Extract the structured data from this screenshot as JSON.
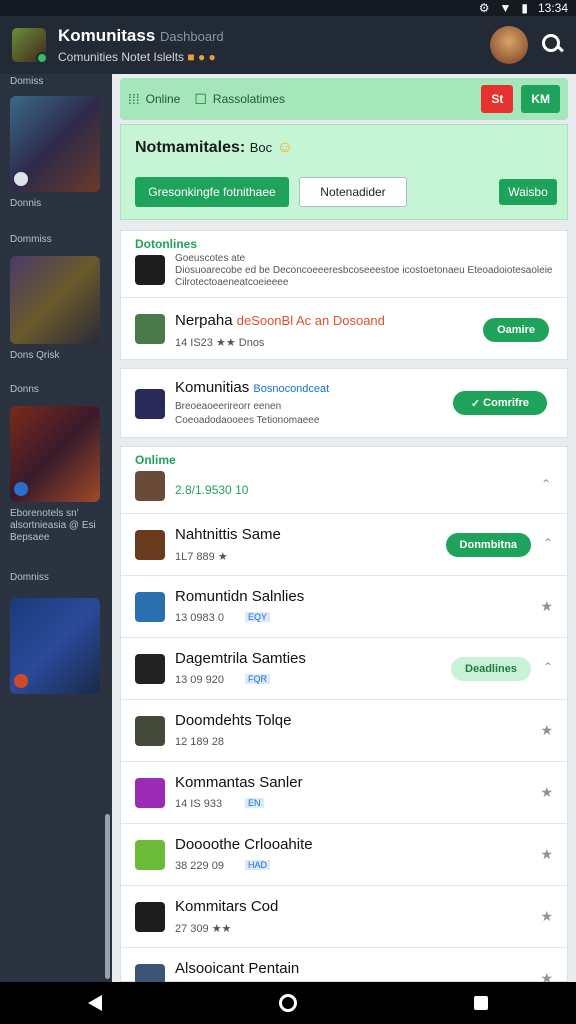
{
  "status": {
    "time": "13:34"
  },
  "header": {
    "title": "Komunitass",
    "title_suffix": "Dashboard",
    "subtitle": "Comunities Notet Islelts"
  },
  "sidebar": {
    "items": [
      {
        "label": "Donnis"
      },
      {
        "label": "Dons Qrisk"
      },
      {
        "label": "Eborenotels sn' alsortnieasia @ Esi Bepsaee"
      },
      {
        "label": ""
      }
    ],
    "headers": [
      "Domiss",
      "Dommiss",
      "Donns",
      "Domniss"
    ]
  },
  "topbar": {
    "label": "Online",
    "text": "Rassolatimes",
    "red_btn": "St",
    "green_btn": "KM"
  },
  "banner": {
    "title": "Notmamitales:",
    "tag": "Boc",
    "primary": "Gresonkingfe fotnithaee",
    "secondary": "Notenadider",
    "small_btn": "Waisbo"
  },
  "section1": {
    "label": "Dotonlines",
    "intro_line1": "Goeuscotes ate",
    "intro_line2": "Diosuoarecobe ed be Deconcoeeeresbcoseeestoe icostoetonaeu Eteoadoiotesaoleie",
    "intro_line3": "Cilrotectoaeneatcoeieeee"
  },
  "featured1": {
    "title": "Nerpaha",
    "accent": "deSoonBl Ac an Dosoand",
    "meta": "14 IS23 ★★ Dnos",
    "button": "Oamire"
  },
  "featured2": {
    "title": "Komunitias",
    "accent": "Bosnocondceat",
    "meta1": "Breoeaoeerireorr eenen",
    "meta2": "Coeoadodaooees Tetionomaeee",
    "button": "Comrifre"
  },
  "section2": {
    "label": "Onlime",
    "first": {
      "value": "2.8/1.9530",
      "badge": "10"
    },
    "rows": [
      {
        "title": "Nahtnittis Same",
        "meta": "1L7 889 ★",
        "button": "Donmbitna",
        "color": "#6a3a1f"
      },
      {
        "title": "Romuntidn Salnlies",
        "meta": "13 0983 0",
        "tag": "EQY",
        "color": "#2a6fb0"
      },
      {
        "title": "Dagemtrila Samties",
        "meta": "13 09 920",
        "tag": "FQR",
        "button": "Deadlines",
        "color": "#222222"
      },
      {
        "title": "Doomdehts Tolqe",
        "meta": "12 189 28",
        "color": "#444a3a"
      },
      {
        "title": "Kommantas Sanler",
        "meta": "14 IS 933",
        "tag": "EN",
        "color": "#9b2bb5"
      },
      {
        "title": "Doooothe Crlooahite",
        "meta": "38 229 09",
        "tag": "HAD",
        "color": "#6cbc3a"
      },
      {
        "title": "Kommitars Cod",
        "meta": "27 309 ★★",
        "color": "#1d1d1d"
      },
      {
        "title": "Alsooicant Pentain",
        "meta": "",
        "color": "#3a5575"
      }
    ]
  },
  "colors": {
    "accent": "#1fa35a",
    "sidebar": "#2b3340",
    "appbar": "#222a35"
  }
}
